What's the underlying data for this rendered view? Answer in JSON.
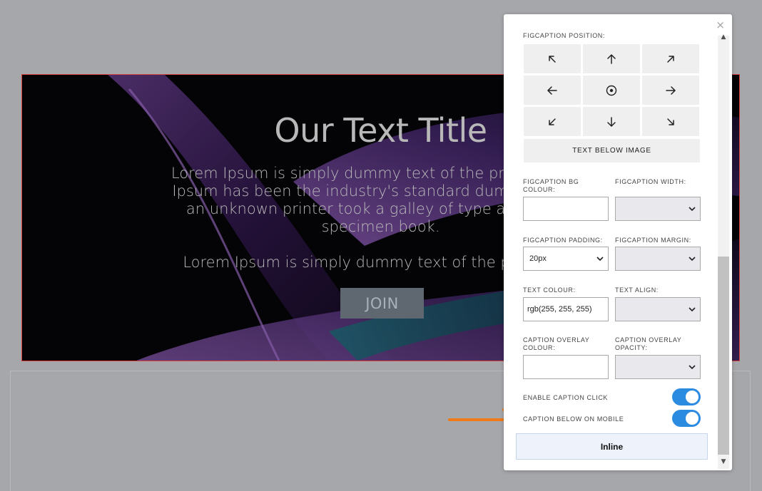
{
  "banner": {
    "title": "Our Text Title",
    "paragraph1": "Lorem Ipsum is simply dummy text of the printing and t\nIpsum has been the industry's standard dummy text ev\nan unknown printer took a galley of type and scram\nspecimen book.",
    "paragraph2": "Lorem Ipsum is simply dummy text of the printing ar",
    "button_label": "JOIN"
  },
  "panel": {
    "close_glyph": "×",
    "position_label": "FIGCAPTION POSITION:",
    "position_grid": [
      {
        "name": "top-left",
        "icon": "arrow-up-left-icon"
      },
      {
        "name": "top",
        "icon": "arrow-up-icon"
      },
      {
        "name": "top-right",
        "icon": "arrow-up-right-icon"
      },
      {
        "name": "left",
        "icon": "arrow-left-icon"
      },
      {
        "name": "center",
        "icon": "center-dot-icon"
      },
      {
        "name": "right",
        "icon": "arrow-right-icon"
      },
      {
        "name": "bottom-left",
        "icon": "arrow-down-left-icon"
      },
      {
        "name": "bottom",
        "icon": "arrow-down-icon"
      },
      {
        "name": "bottom-right",
        "icon": "arrow-down-right-icon"
      }
    ],
    "text_below_image": "TEXT BELOW IMAGE",
    "bg_colour_label": "FIGCAPTION BG COLOUR:",
    "bg_colour_value": "",
    "width_label": "FIGCAPTION WIDTH:",
    "width_value": "",
    "padding_label": "FIGCAPTION PADDING:",
    "padding_value": "20px",
    "margin_label": "FIGCAPTION MARGIN:",
    "margin_value": "",
    "text_colour_label": "TEXT COLOUR:",
    "text_colour_value": "rgb(255, 255, 255)",
    "text_align_label": "TEXT ALIGN:",
    "text_align_value": "",
    "overlay_colour_label": "CAPTION OVERLAY COLOUR:",
    "overlay_colour_value": "",
    "overlay_opacity_label": "CAPTION OVERLAY OPACITY:",
    "overlay_opacity_value": "",
    "enable_click_label": "ENABLE CAPTION CLICK",
    "enable_click_on": true,
    "below_mobile_label": "CAPTION BELOW ON MOBILE",
    "below_mobile_on": true,
    "inline_label": "Inline"
  },
  "colors": {
    "toggle_on": "#2b8be0",
    "arrow": "#f07a18",
    "banner_border": "#d9423f"
  }
}
